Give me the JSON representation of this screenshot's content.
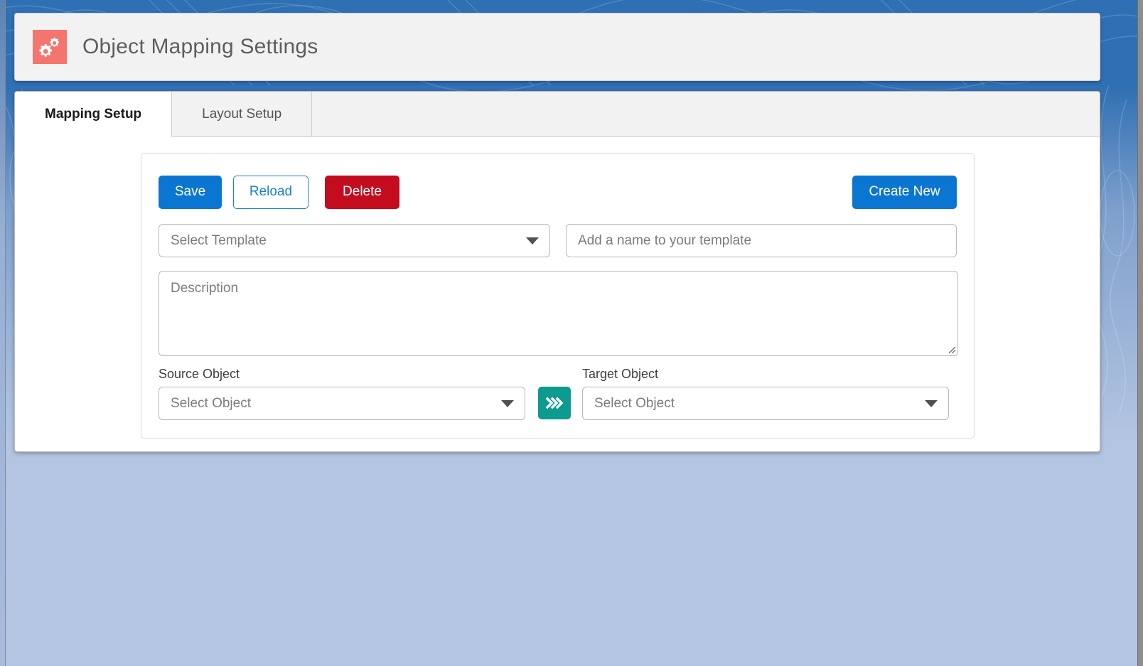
{
  "header": {
    "title": "Object Mapping Settings",
    "icon": "gears-icon",
    "icon_bg": "#f4756e"
  },
  "tabs": [
    {
      "label": "Mapping Setup",
      "active": true
    },
    {
      "label": "Layout Setup",
      "active": false
    }
  ],
  "toolbar": {
    "save_label": "Save",
    "reload_label": "Reload",
    "delete_label": "Delete",
    "create_new_label": "Create New"
  },
  "form": {
    "template_select": {
      "placeholder": "Select Template",
      "value": "",
      "icon": "chevron-down-icon"
    },
    "template_name": {
      "placeholder": "Add a name to your template",
      "value": ""
    },
    "description": {
      "placeholder": "Description",
      "value": ""
    },
    "source_object": {
      "label": "Source Object",
      "placeholder": "Select Object",
      "value": "",
      "icon": "chevron-down-icon"
    },
    "target_object": {
      "label": "Target Object",
      "placeholder": "Select Object",
      "value": "",
      "icon": "chevron-down-icon"
    },
    "swap_button": {
      "icon": "double-chevron-right-icon",
      "color": "#0d9b8f"
    }
  },
  "colors": {
    "primary_blue": "#0b76d1",
    "danger_red": "#c30c1e",
    "teal": "#0d9b8f",
    "salmon": "#f4756e",
    "page_blue": "#2f6fb3",
    "page_blue_light": "#b4c5e1"
  }
}
